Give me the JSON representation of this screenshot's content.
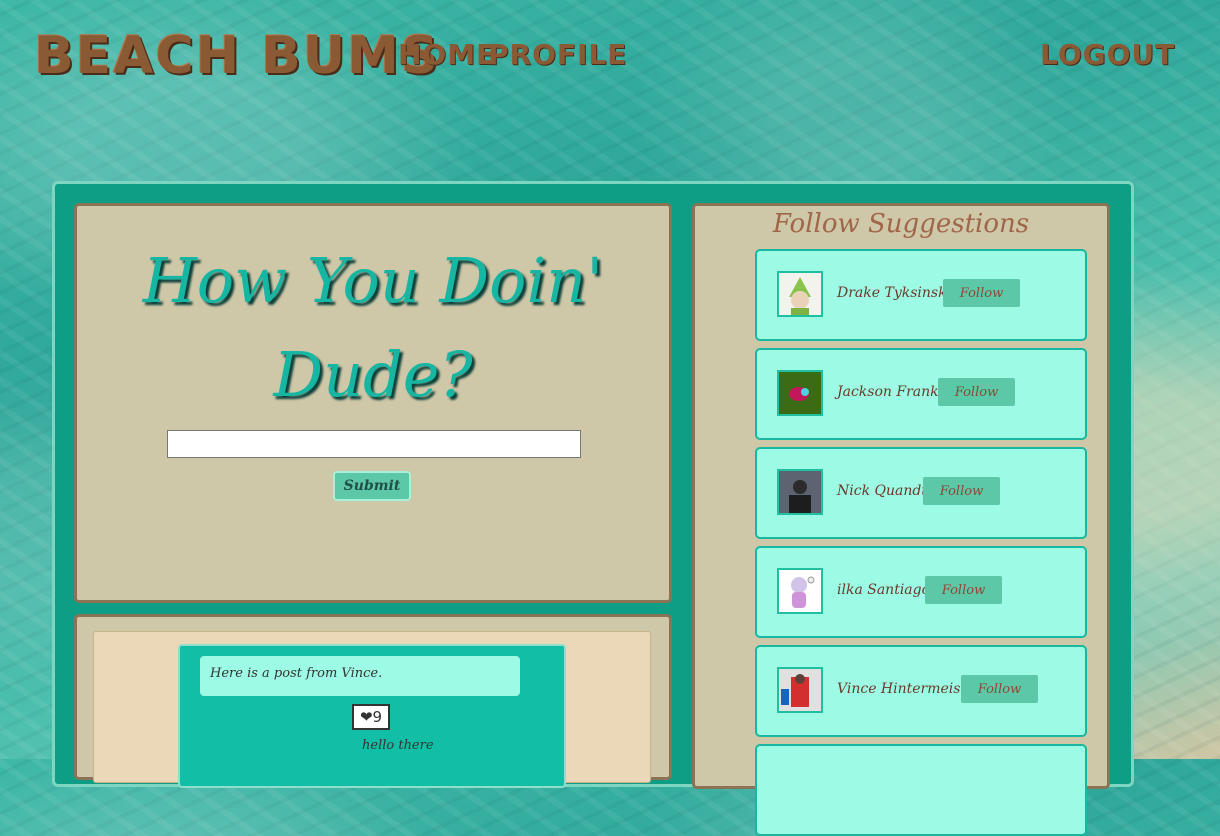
{
  "header": {
    "brand": "BEACH BUMS",
    "nav_home": "HOME",
    "nav_profile": "PROFILE",
    "nav_logout": "LOGOUT"
  },
  "composer": {
    "headline_line1": "How You Doin'",
    "headline_line2": "Dude?",
    "input_value": "",
    "submit_label": "Submit"
  },
  "feed": {
    "posts": [
      {
        "text": "Here is a post from Vince.",
        "like_label": "❤9",
        "comment": "hello there"
      }
    ]
  },
  "suggestions": {
    "title": "Follow Suggestions",
    "follow_label": "Follow",
    "users": [
      {
        "name": "Drake Tyksinski"
      },
      {
        "name": "Jackson Franks"
      },
      {
        "name": "Nick Quandt"
      },
      {
        "name": "ilka Santiago"
      },
      {
        "name": "Vince Hintermeister"
      }
    ]
  },
  "colors": {
    "panel_bg": "#cec7a8",
    "frame_bg": "#0e9e86",
    "card_bg": "#9dfae4",
    "button_bg": "#5cc8a8",
    "brand_brown": "#8a5a35"
  }
}
